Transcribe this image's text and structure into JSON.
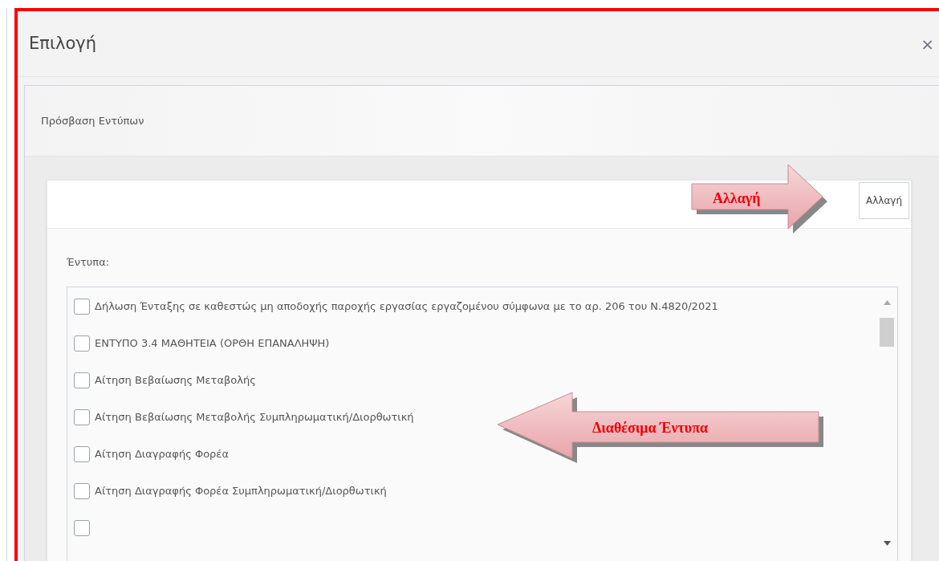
{
  "dialog": {
    "title": "Επιλογή",
    "close": "×"
  },
  "panel": {
    "title": "Πρόσβαση Εντύπων",
    "change_button": "Αλλαγή",
    "forms_label": "Έντυπα:",
    "forms": [
      {
        "label": "Δήλωση Ένταξης σε καθεστώς μη αποδοχής παροχής εργασίας εργαζομένου σύμφωνα με το αρ. 206 του Ν.4820/2021",
        "checked": false
      },
      {
        "label": "ΕΝΤΥΠΟ 3.4 ΜΑΘΗΤΕΙΑ (ΟΡΘΗ ΕΠΑΝΑΛΗΨΗ)",
        "checked": false
      },
      {
        "label": "Αίτηση Βεβαίωσης Μεταβολής",
        "checked": false
      },
      {
        "label": "Αίτηση Βεβαίωσης Μεταβολής Συμπληρωματική/Διορθωτική",
        "checked": false
      },
      {
        "label": "Αίτηση Διαγραφής Φορέα",
        "checked": false
      },
      {
        "label": "Αίτηση Διαγραφής Φορέα Συμπληρωματική/Διορθωτική",
        "checked": false
      },
      {
        "checked": false
      }
    ]
  },
  "annotations": [
    {
      "text": "Αλλαγή",
      "kind": "right"
    },
    {
      "text": "Διαθέσιμα Έντυπα",
      "kind": "left"
    }
  ]
}
